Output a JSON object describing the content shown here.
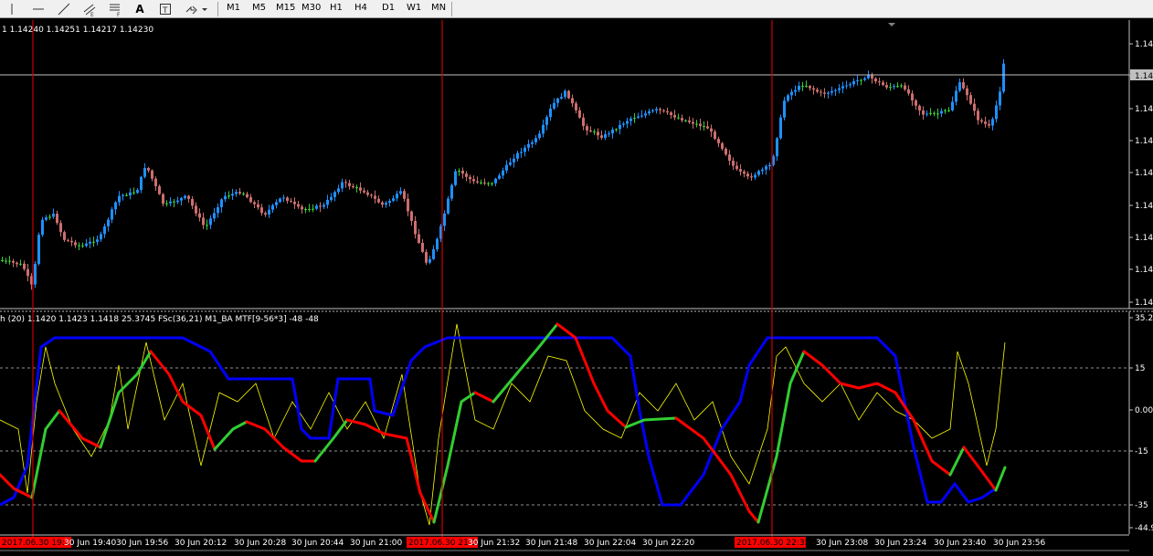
{
  "toolbar": {
    "timeframes": [
      "M1",
      "M5",
      "M15",
      "M30",
      "H1",
      "H4",
      "D1",
      "W1",
      "MN"
    ],
    "text_tool_label": "A"
  },
  "price_panel": {
    "ohlc": "1  1.14240 1.14251 1.14217 1.14230",
    "price_labels": [
      "1.14",
      "1.14",
      "1.14",
      "1.14",
      "1.14",
      "1.14",
      "1.14",
      "1.14",
      "1.14"
    ],
    "current_price_label": "1.14",
    "bull_color": "#1e90ff",
    "bear_color": "#cd6e6e",
    "neutral_color": "#32cd32"
  },
  "indicator_panel": {
    "header": "h (20) 1.1420 1.1423 1.1418 25.3745  FSc(36,21)  M1_BA MTF[9-56*3] -48 -48",
    "levels": [
      "35.2",
      "15",
      "0.00",
      "-15",
      "-35",
      "-44.9"
    ],
    "line_colors": {
      "slow": "#0000ff",
      "signal_down": "#ff0000",
      "signal_up": "#32cd32",
      "fast": "#ffff00"
    }
  },
  "time_axis": {
    "labels": [
      "2017.06.30 19:13",
      "30 Jun 19:40",
      "30 Jun 19:56",
      "30 Jun 20:12",
      "30 Jun 20:28",
      "30 Jun 20:44",
      "30 Jun 21:00",
      "2017.06.30 21:16",
      "30 Jun 21:32",
      "30 Jun 21:48",
      "30 Jun 22:04",
      "30 Jun 22:20",
      "2017.06.30 22:35",
      "30 Jun 23:08",
      "30 Jun 23:24",
      "30 Jun 23:40",
      "30 Jun 23:56"
    ],
    "highlighted": [
      0,
      7,
      12
    ]
  }
}
